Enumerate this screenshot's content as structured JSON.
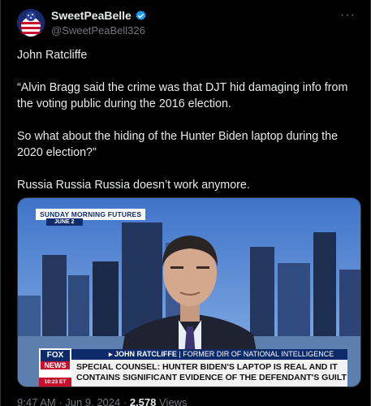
{
  "author": {
    "name": "SweetPeaBelle",
    "handle": "@SweetPeaBell326"
  },
  "tweet": {
    "lines": [
      "John Ratcliffe",
      "“Alvin Bragg said the crime was that DJT hid damaging info from the voting public during the 2016 election.",
      "So what about the hiding of the Hunter Biden laptop during the 2020 election?”",
      "Russia Russia Russia doesn’t work anymore."
    ]
  },
  "media": {
    "show_name": "SUNDAY MORNING FUTURES",
    "show_date": "JUNE 2",
    "network_top": "FOX",
    "network_bottom": "NEWS",
    "clock": "10:23 ET",
    "chyron_name": "▸ JOHN RATCLIFFE",
    "chyron_title": "| FORMER DIR OF NATIONAL INTELLIGENCE",
    "chyron_headline_1": "SPECIAL COUNSEL: HUNTER BIDEN'S LAPTOP IS REAL AND IT",
    "chyron_headline_2": "CONTAINS SIGNIFICANT EVIDENCE OF THE DEFENDANT'S GUILT"
  },
  "meta": {
    "time": "9:47 AM",
    "dot": "·",
    "date": "Jun 9, 2024",
    "views_count": "2,578",
    "views_label": "Views"
  },
  "icons": {
    "more": "more-icon",
    "verified": "verified-badge-icon"
  },
  "colors": {
    "verified_blue": "#1d9bf0",
    "fox_blue": "#0d2a6b",
    "fox_red": "#c8102e"
  }
}
